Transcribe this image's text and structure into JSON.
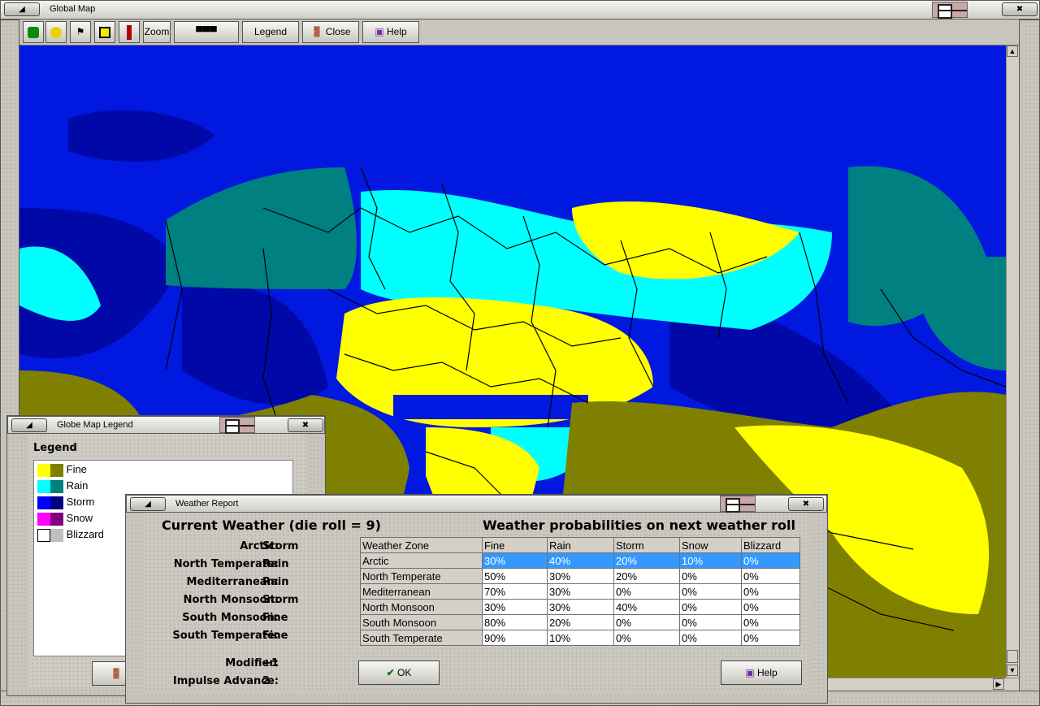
{
  "main_window": {
    "title": "Global Map",
    "toolbar": {
      "zoom_label": "Zoom",
      "legend_label": "Legend",
      "close_label": "Close",
      "help_label": "Help"
    }
  },
  "legend_window": {
    "title": "Globe Map Legend",
    "heading": "Legend",
    "items": [
      {
        "label": "Fine",
        "color_light": "#ffff00",
        "color_dark": "#808000"
      },
      {
        "label": "Rain",
        "color_light": "#00ffff",
        "color_dark": "#008080"
      },
      {
        "label": "Storm",
        "color_light": "#0000ff",
        "color_dark": "#000080"
      },
      {
        "label": "Snow",
        "color_light": "#ff00ff",
        "color_dark": "#800080"
      },
      {
        "label": "Blizzard",
        "color_light": "#ffffff",
        "color_dark": "#c0c0c0"
      }
    ]
  },
  "weather_window": {
    "title": "Weather Report",
    "current_heading": "Current Weather (die roll = 9)",
    "prob_heading": "Weather probabilities on next weather roll",
    "current": [
      {
        "zone": "Arctic:",
        "weather": "Storm"
      },
      {
        "zone": "North Temperate:",
        "weather": "Rain"
      },
      {
        "zone": "Mediterranean:",
        "weather": "Rain"
      },
      {
        "zone": "North Monsoon:",
        "weather": "Storm"
      },
      {
        "zone": "South Monsoon:",
        "weather": "Fine"
      },
      {
        "zone": "South Temperate:",
        "weather": "Fine"
      }
    ],
    "modifier_label": "Modifier:",
    "modifier_value": "+1",
    "impulse_label": "Impulse Advance:",
    "impulse_value": "2",
    "table": {
      "headers": [
        "Weather Zone",
        "Fine",
        "Rain",
        "Storm",
        "Snow",
        "Blizzard"
      ],
      "rows": [
        [
          "Arctic",
          "30%",
          "40%",
          "20%",
          "10%",
          "0%"
        ],
        [
          "North Temperate",
          "50%",
          "30%",
          "20%",
          "0%",
          "0%"
        ],
        [
          "Mediterranean",
          "70%",
          "30%",
          "0%",
          "0%",
          "0%"
        ],
        [
          "North Monsoon",
          "30%",
          "30%",
          "40%",
          "0%",
          "0%"
        ],
        [
          "South Monsoon",
          "80%",
          "20%",
          "0%",
          "0%",
          "0%"
        ],
        [
          "South Temperate",
          "90%",
          "10%",
          "0%",
          "0%",
          "0%"
        ]
      ]
    },
    "ok_label": "OK",
    "help_label": "Help"
  },
  "colors": {
    "ocean_storm": "#0018e0",
    "ocean_deep": "#000080",
    "fine_land": "#ffff00",
    "fine_dark": "#808000",
    "rain_land": "#00ffff",
    "rain_dark": "#008080",
    "selection": "#3399ff"
  }
}
